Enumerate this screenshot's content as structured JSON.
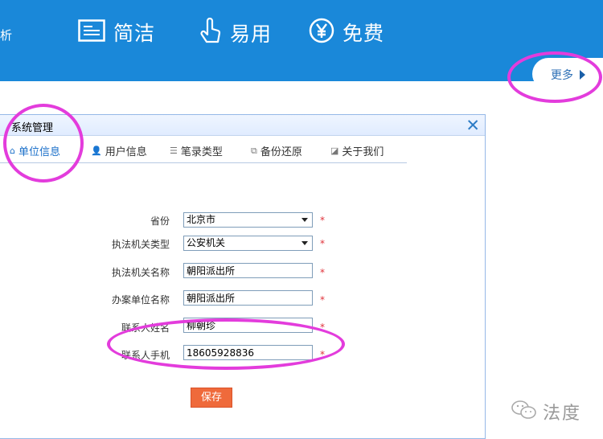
{
  "banner": {
    "edge_text": "析",
    "features": [
      {
        "icon": "document-icon",
        "label": "简洁"
      },
      {
        "icon": "touch-hand-icon",
        "label": "易用"
      },
      {
        "icon": "yen-circle-icon",
        "label": "免费"
      }
    ],
    "more_label": "更多"
  },
  "dialog": {
    "title": "系统管理",
    "tabs": [
      {
        "icon": "home-icon",
        "label": "单位信息",
        "active": true
      },
      {
        "icon": "user-icon",
        "label": "用户信息",
        "active": false
      },
      {
        "icon": "list-icon",
        "label": "笔录类型",
        "active": false
      },
      {
        "icon": "backup-icon",
        "label": "备份还原",
        "active": false
      },
      {
        "icon": "edit-icon",
        "label": "关于我们",
        "active": false
      }
    ],
    "form": {
      "province_label": "省份",
      "province_value": "北京市",
      "agency_type_label": "执法机关类型",
      "agency_type_value": "公安机关",
      "agency_name_label": "执法机关名称",
      "agency_name_value": "朝阳派出所",
      "unit_name_label": "办案单位名称",
      "unit_name_value": "朝阳派出所",
      "contact_name_label": "联系人姓名",
      "contact_name_value": "柳朝珍",
      "contact_phone_label": "联系人手机",
      "contact_phone_value": "18605928836",
      "required_mark": "*",
      "save_label": "保存"
    }
  },
  "watermark": {
    "text": "法度"
  },
  "colors": {
    "banner": "#1a88d9",
    "accent": "#1a6fc9",
    "save_button": "#ef6a3b",
    "annotation": "#e33cdc"
  }
}
